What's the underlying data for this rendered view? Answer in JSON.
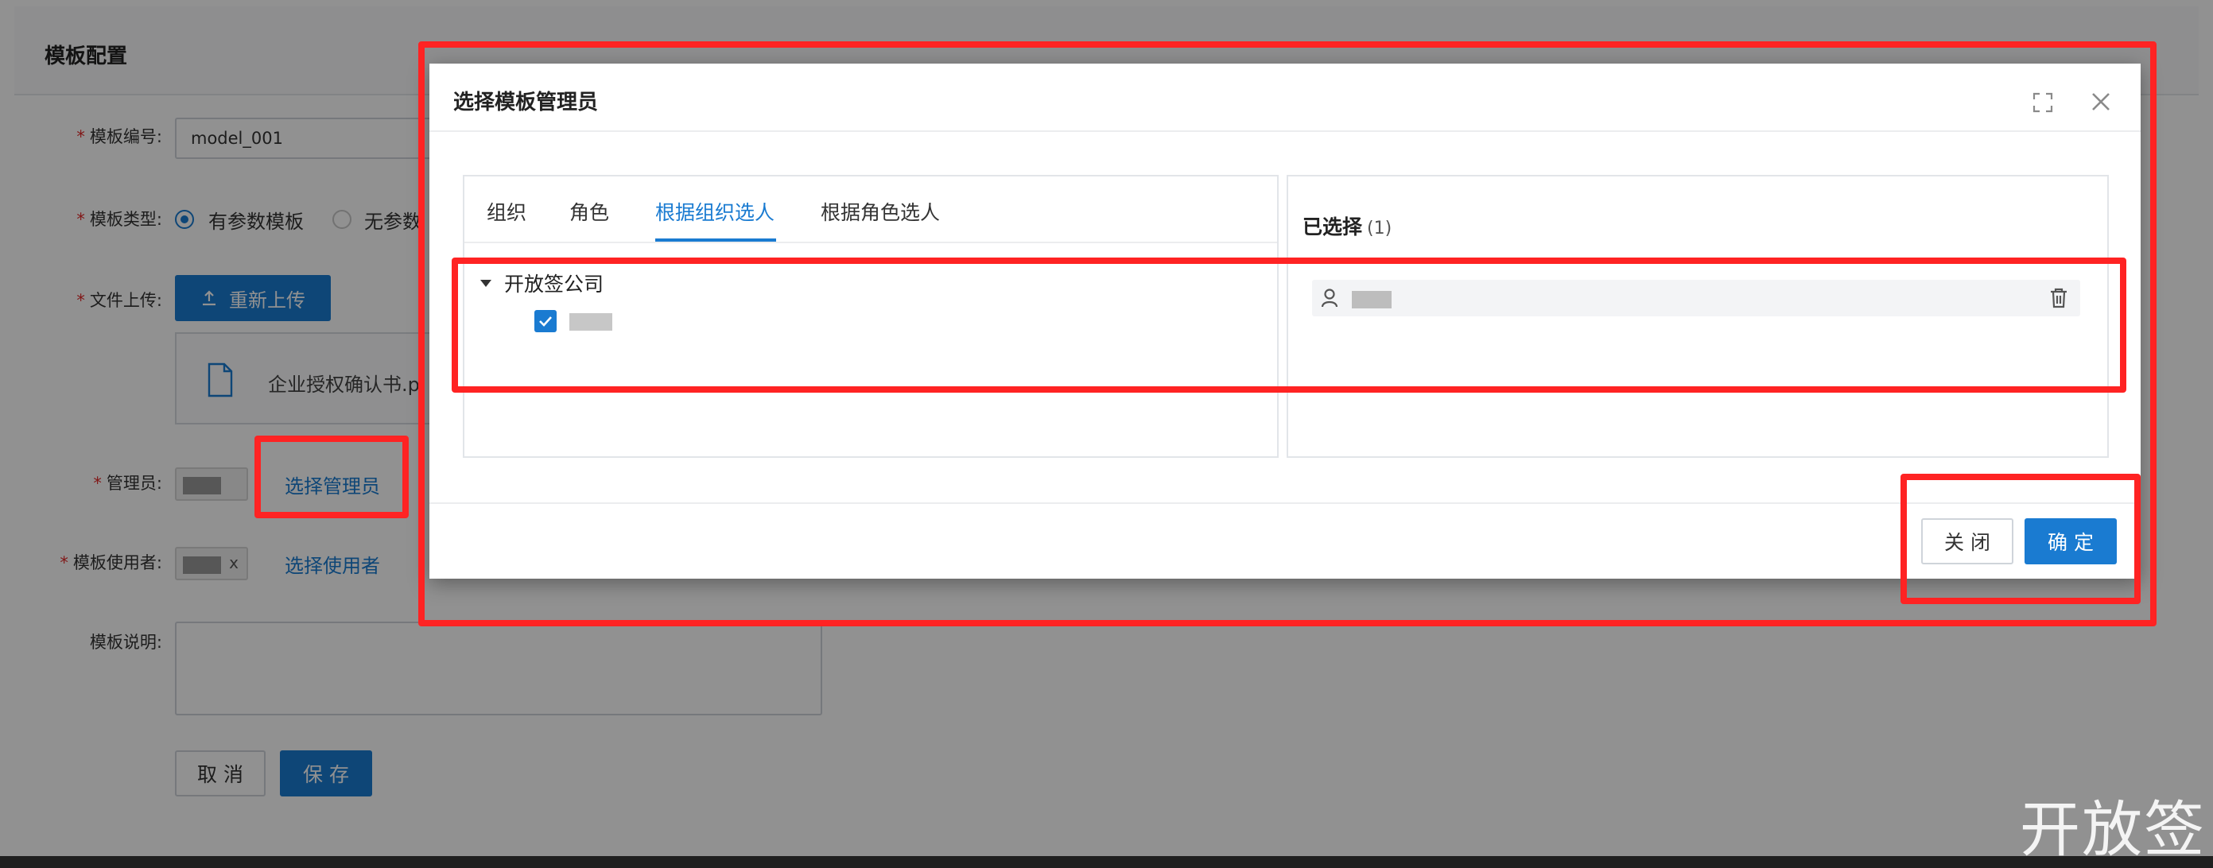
{
  "page": {
    "title": "模板配置"
  },
  "form": {
    "template_no": {
      "label": "模板编号:",
      "value": "model_001"
    },
    "template_type": {
      "label": "模板类型:",
      "options": [
        "有参数模板",
        "无参数"
      ],
      "selected": "有参数模板"
    },
    "upload": {
      "label": "文件上传:",
      "button": "重新上传",
      "file_name": "企业授权确认书.p"
    },
    "admin": {
      "label": "管理员:",
      "link": "选择管理员"
    },
    "users": {
      "label": "模板使用者:",
      "link": "选择使用者",
      "chip_remove": "x"
    },
    "description": {
      "label": "模板说明:"
    },
    "required_mark": "*",
    "cancel_button": "取 消",
    "save_button": "保 存"
  },
  "modal": {
    "title": "选择模板管理员",
    "tabs": [
      "组织",
      "角色",
      "根据组织选人",
      "根据角色选人"
    ],
    "active_tab": "根据组织选人",
    "tree_root": "开放签公司",
    "selected": {
      "title": "已选择",
      "count": "(1)"
    },
    "close_button": "关 闭",
    "ok_button": "确 定"
  },
  "watermark": "开放签",
  "colors": {
    "primary": "#1a7bd1",
    "annotation": "#ff2323",
    "required": "#e32b2b"
  }
}
